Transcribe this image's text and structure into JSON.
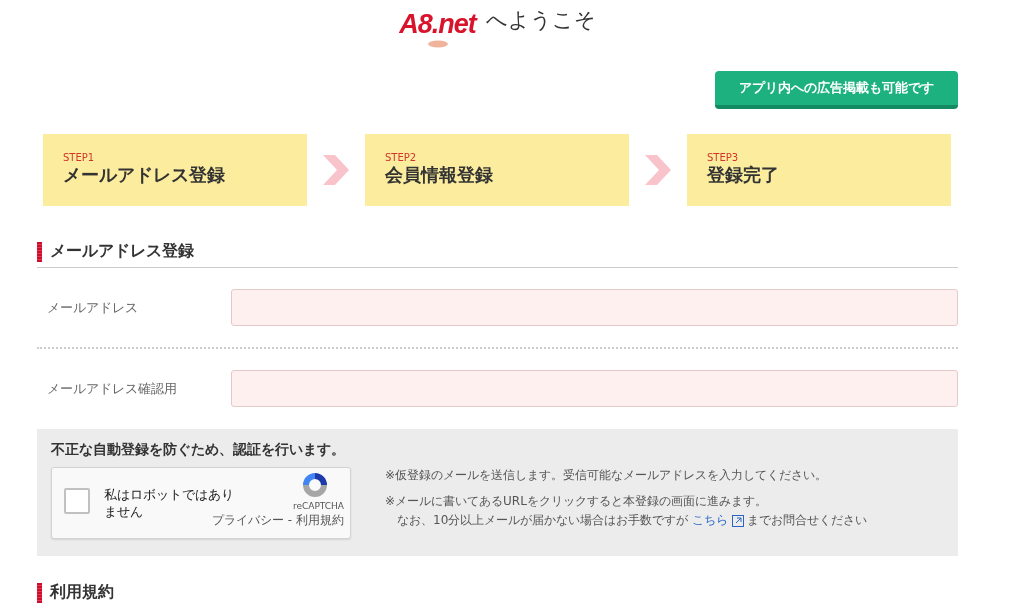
{
  "header": {
    "logo": "A8.net",
    "welcome": "へようこそ",
    "app_button": "アプリ内への広告掲載も可能です"
  },
  "steps": [
    {
      "step": "STEP1",
      "title": "メールアドレス登録"
    },
    {
      "step": "STEP2",
      "title": "会員情報登録"
    },
    {
      "step": "STEP3",
      "title": "登録完了"
    }
  ],
  "section_title": "メールアドレス登録",
  "fields": [
    {
      "label": "メールアドレス"
    },
    {
      "label": "メールアドレス確認用"
    }
  ],
  "captcha": {
    "heading": "不正な自動登録を防ぐため、認証を行います。",
    "checkbox": {
      "label": "私はロボットではありません",
      "checked": false
    },
    "brand": "reCAPTCHA",
    "links": "プライバシー - 利用規約",
    "notes": [
      "※仮登録のメールを送信します。受信可能なメールアドレスを入力してください。",
      "※メールに書いてあるURLをクリックすると本登録の画面に進みます。"
    ],
    "contact": {
      "before": "なお、10分以上メールが届かない場合はお手数ですが",
      "link": "こちら",
      "after": "までお問合せください"
    }
  },
  "next_section_title": "利用規約"
}
